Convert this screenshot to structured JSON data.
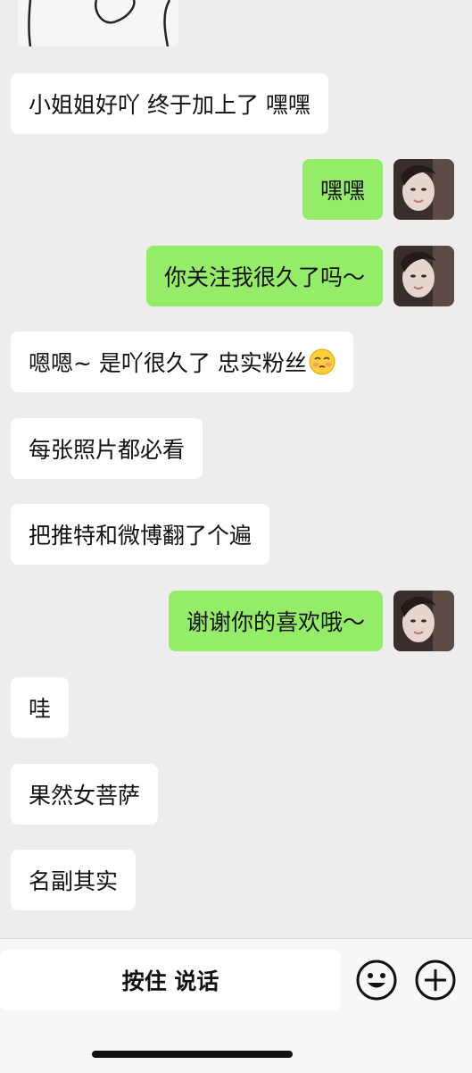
{
  "chat": {
    "messages": [
      {
        "side": "left",
        "text": "小姐姐好吖 终于加上了 嘿嘿"
      },
      {
        "side": "right",
        "text": "嘿嘿"
      },
      {
        "side": "right",
        "text": "你关注我很久了吗～"
      },
      {
        "side": "left",
        "text": "嗯嗯~ 是吖很久了 忠实粉丝"
      },
      {
        "side": "left",
        "text": "每张照片都必看"
      },
      {
        "side": "left",
        "text": "把推特和微博翻了个遍"
      },
      {
        "side": "right",
        "text": "谢谢你的喜欢哦～"
      },
      {
        "side": "left",
        "text": "哇"
      },
      {
        "side": "left",
        "text": "果然女菩萨"
      },
      {
        "side": "left",
        "text": "名副其实"
      }
    ]
  },
  "input_bar": {
    "voice_label": "按住 说话",
    "emoji_icon": "smiley-face-icon",
    "plus_icon": "plus-circle-icon"
  },
  "colors": {
    "background": "#ededed",
    "incoming_bubble": "#ffffff",
    "outgoing_bubble": "#95ec69"
  }
}
